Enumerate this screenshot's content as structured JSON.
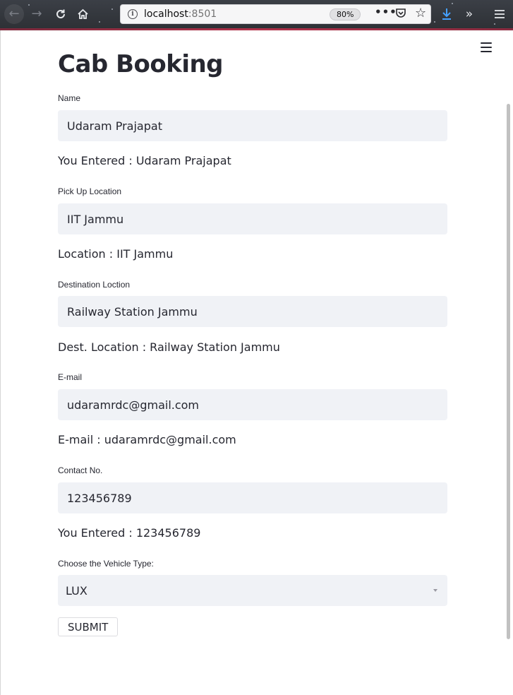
{
  "browser": {
    "url_host": "localhost",
    "url_port": ":8501",
    "zoom": "80%"
  },
  "page": {
    "title": "Cab Booking"
  },
  "fields": {
    "name": {
      "label": "Name",
      "value": "Udaram Prajapat",
      "echo": "You Entered : Udaram Prajapat"
    },
    "pickup": {
      "label": "Pick Up Location",
      "value": "IIT Jammu",
      "echo": "Location : IIT Jammu"
    },
    "destination": {
      "label": "Destination Loction",
      "value": "Railway Station Jammu",
      "echo": "Dest. Location : Railway Station Jammu"
    },
    "email": {
      "label": "E-mail",
      "value": "udaramrdc@gmail.com",
      "echo": "E-mail : udaramrdc@gmail.com"
    },
    "contact": {
      "label": "Contact No.",
      "value": "123456789",
      "echo": "You Entered : 123456789"
    },
    "vehicle": {
      "label": "Choose the Vehicle Type:",
      "selected": "LUX"
    }
  },
  "submit_label": "SUBMIT"
}
